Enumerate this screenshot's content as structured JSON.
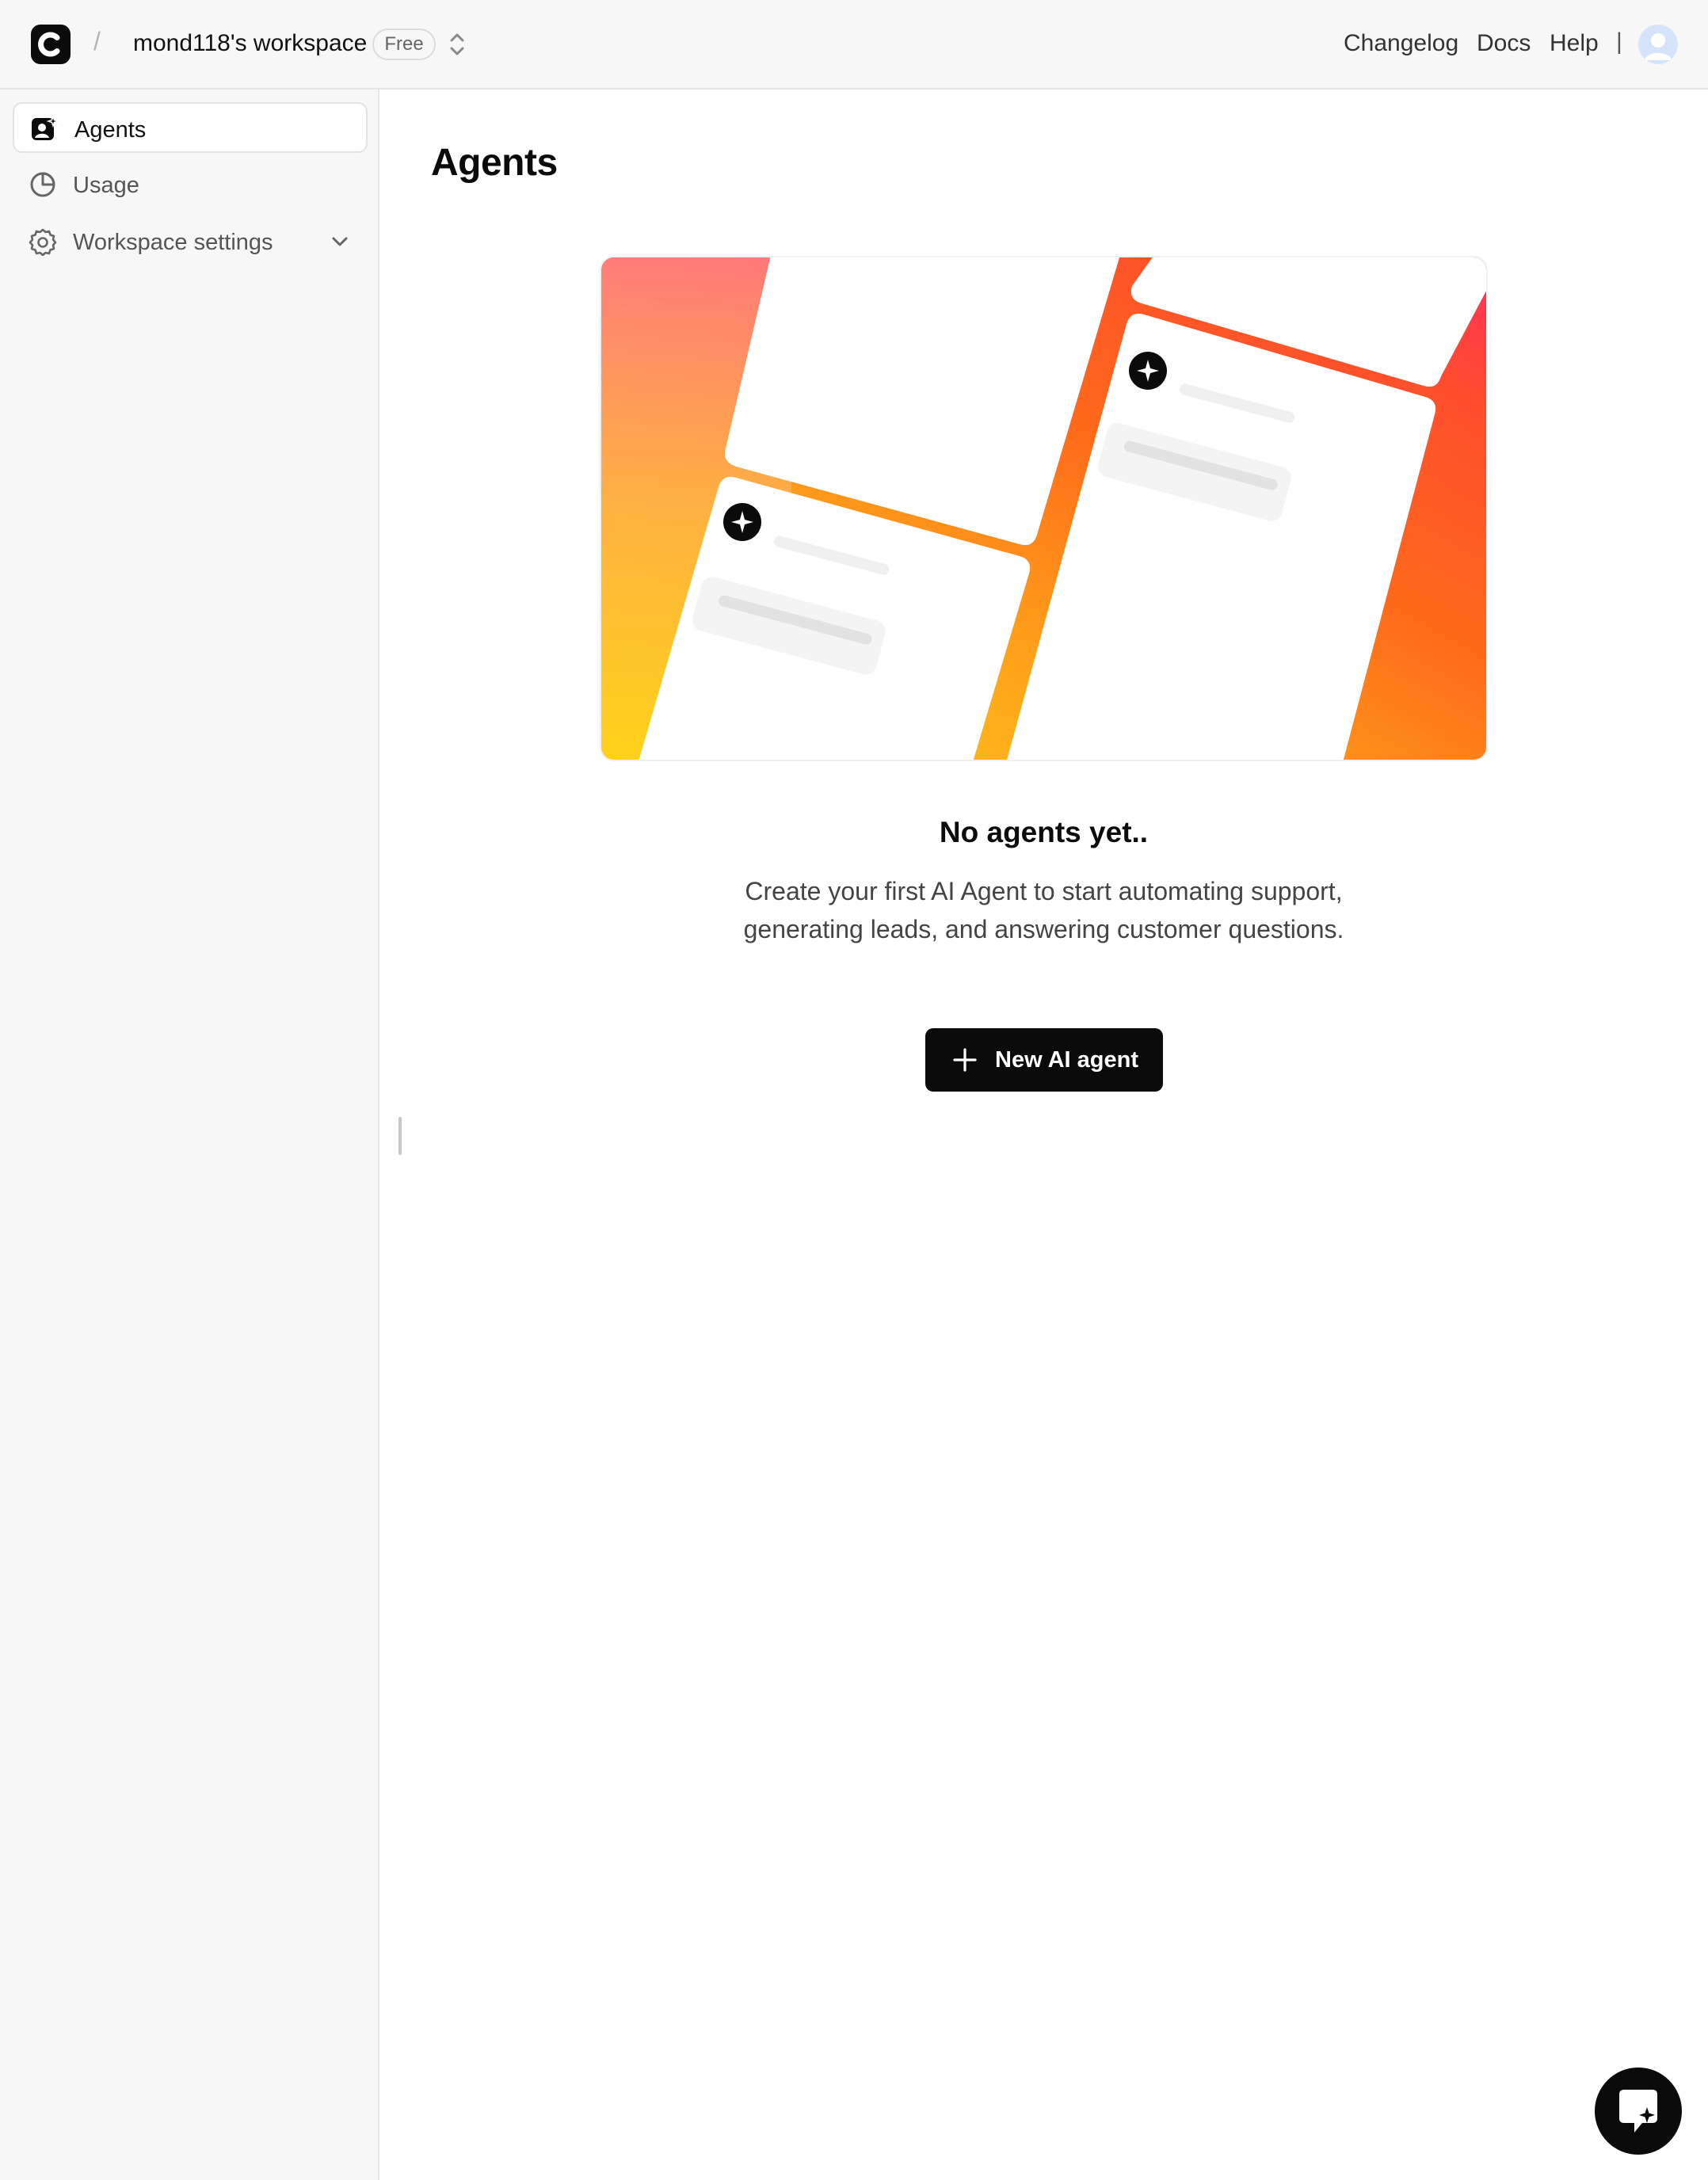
{
  "header": {
    "breadcrumb_separator": "/",
    "workspace_name": "mond118's workspace",
    "plan_badge": "Free",
    "links": {
      "changelog": "Changelog",
      "docs": "Docs",
      "help": "Help"
    },
    "divider": "|"
  },
  "sidebar": {
    "items": [
      {
        "label": "Agents",
        "icon": "agent-icon",
        "active": true
      },
      {
        "label": "Usage",
        "icon": "pie-chart-icon",
        "active": false
      },
      {
        "label": "Workspace settings",
        "icon": "gear-icon",
        "active": false,
        "expandable": true
      }
    ]
  },
  "main": {
    "title": "Agents",
    "empty_state": {
      "title": "No agents yet..",
      "description_line1": "Create your first AI Agent to start automating support,",
      "description_line2": "generating leads, and answering customer questions.",
      "button_label": "New AI agent"
    }
  },
  "colors": {
    "primary": "#0b0b0b",
    "sidebar_bg": "#f7f7f7",
    "avatar_bg": "#d6e4fb"
  }
}
